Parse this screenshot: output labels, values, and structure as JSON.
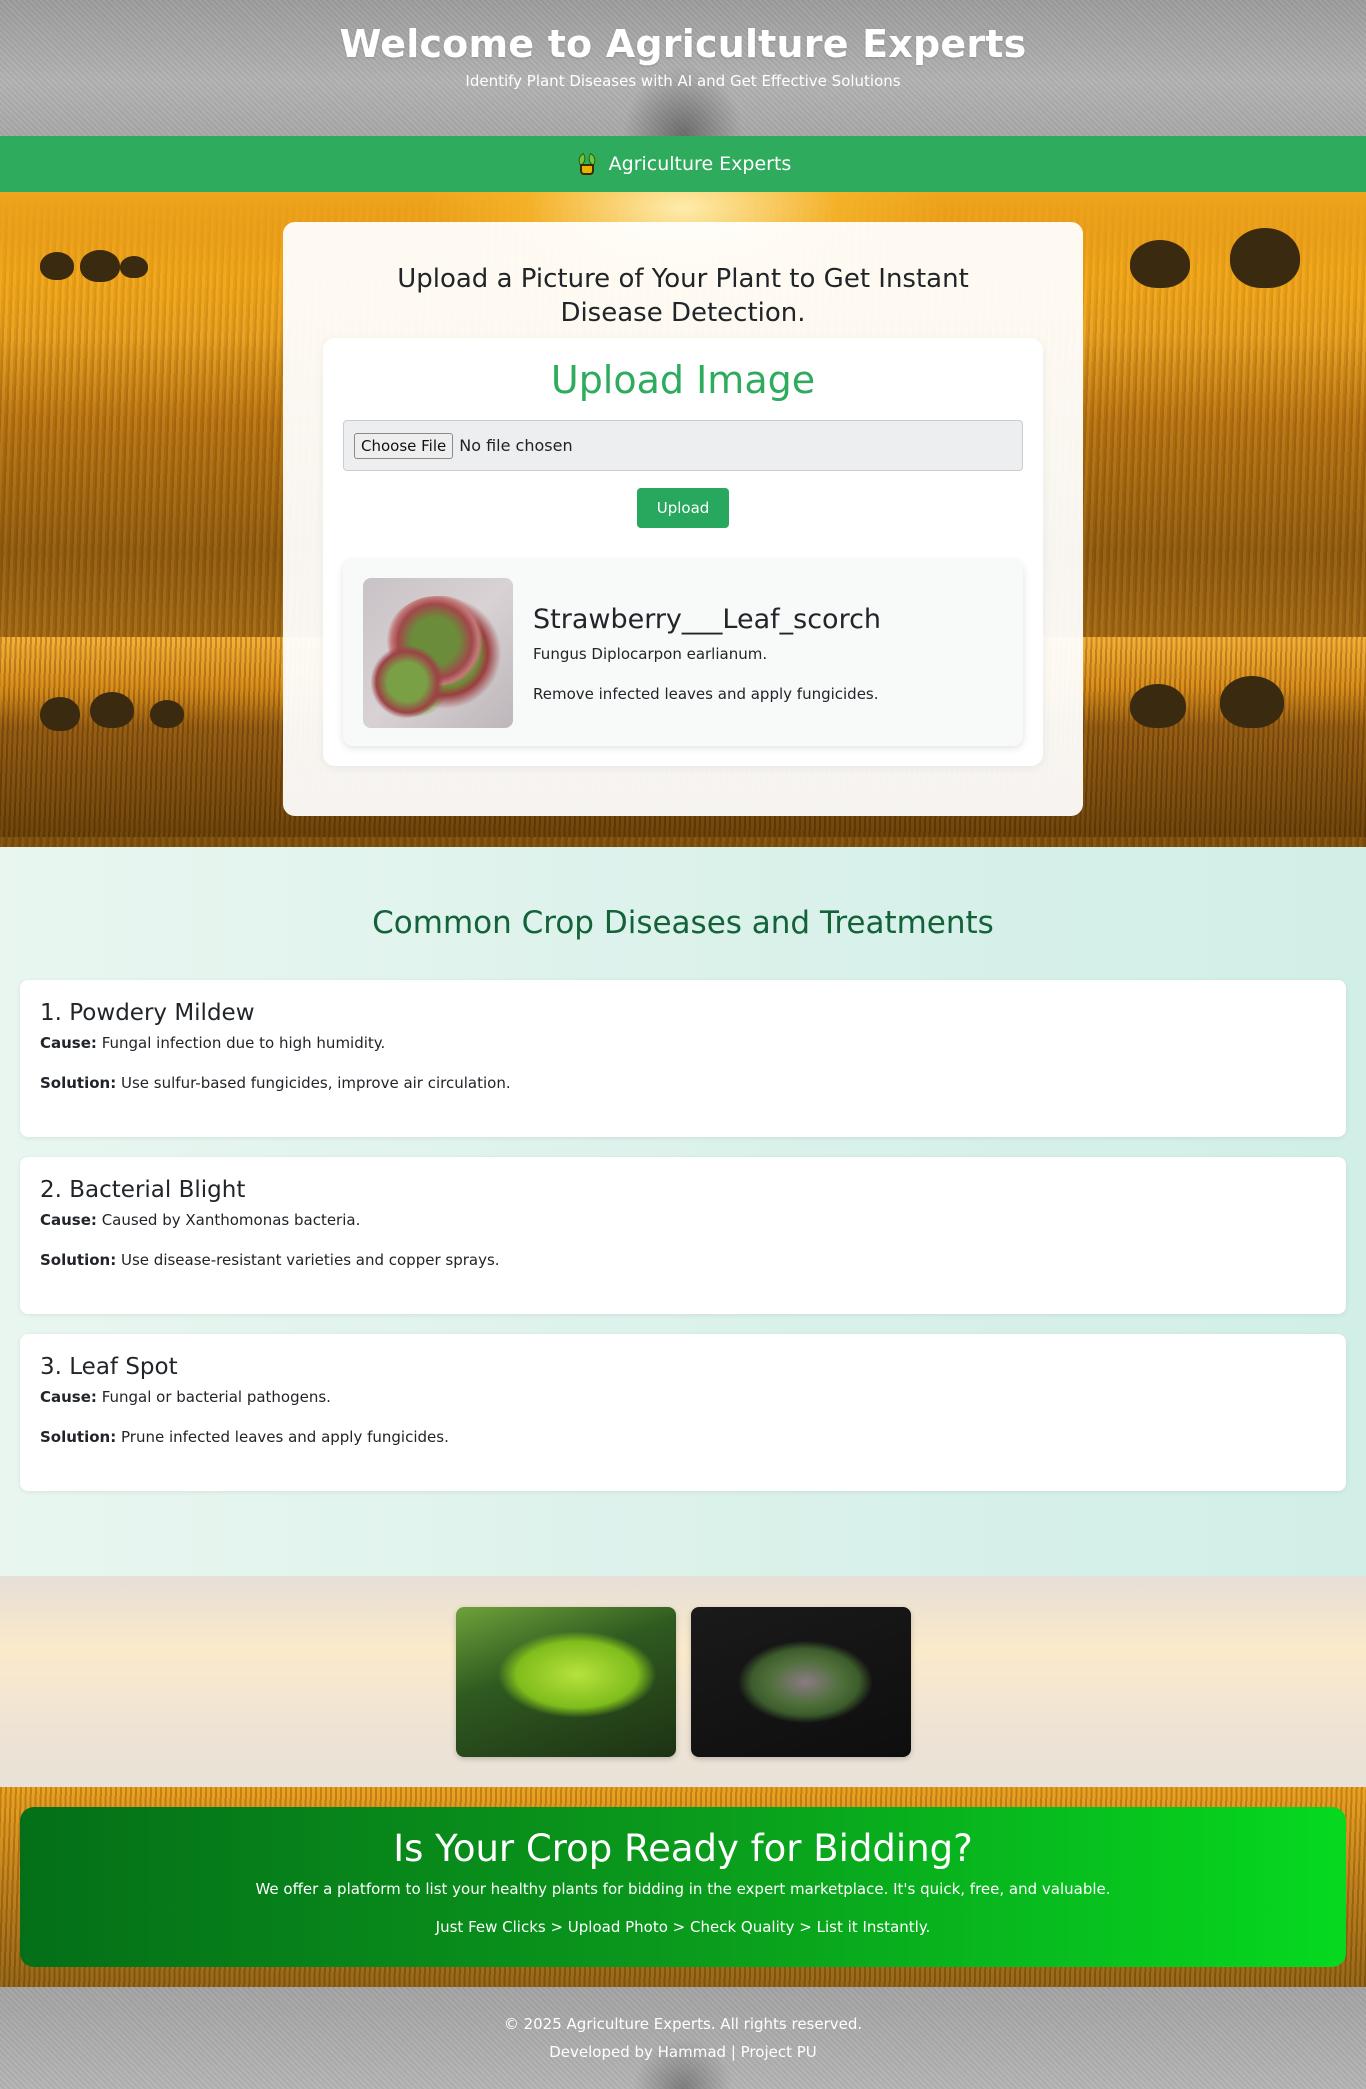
{
  "header": {
    "title": "Welcome to Agriculture Experts",
    "subtitle": "Identify Plant Diseases with AI and Get Effective Solutions"
  },
  "navbar": {
    "brand_icon": "potted-plant-icon",
    "brand_label": "Agriculture Experts"
  },
  "upload_section": {
    "heading": "Upload a Picture of Your Plant to Get Instant Disease Detection.",
    "box_title": "Upload Image",
    "choose_file_label": "Choose File",
    "file_status": "No file chosen",
    "upload_button": "Upload"
  },
  "result": {
    "title": "Strawberry___Leaf_scorch",
    "cause": "Fungus Diplocarpon earlianum.",
    "solution": "Remove infected leaves and apply fungicides."
  },
  "diseases": {
    "title": "Common Crop Diseases and Treatments",
    "cause_label": "Cause:",
    "solution_label": "Solution:",
    "items": [
      {
        "name": "1. Powdery Mildew",
        "cause": "Fungal infection due to high humidity.",
        "solution": "Use sulfur-based fungicides, improve air circulation."
      },
      {
        "name": "2. Bacterial Blight",
        "cause": "Caused by Xanthomonas bacteria.",
        "solution": "Use disease-resistant varieties and copper sprays."
      },
      {
        "name": "3. Leaf Spot",
        "cause": "Fungal or bacterial pathogens.",
        "solution": "Prune infected leaves and apply fungicides."
      }
    ]
  },
  "cta": {
    "title": "Is Your Crop Ready for Bidding?",
    "text": "We offer a platform to list your healthy plants for bidding in the expert marketplace. It's quick, free, and valuable.",
    "steps": "Just Few Clicks > Upload Photo > Check Quality > List it Instantly."
  },
  "footer": {
    "copyright": "© 2025 Agriculture Experts. All rights reserved.",
    "credit": "Developed by Hammad | Project PU"
  },
  "colors": {
    "nav_green": "#2fab5e",
    "heading_green": "#14623a",
    "upload_green": "#2fab5e",
    "cta_start": "#046f18",
    "cta_end": "#05d91f"
  }
}
